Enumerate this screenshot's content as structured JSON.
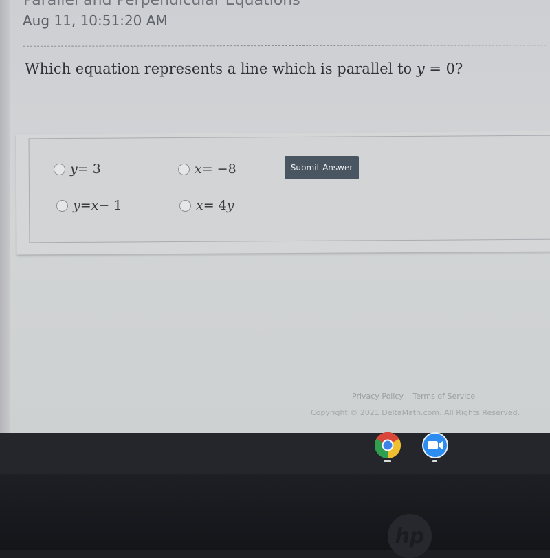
{
  "page": {
    "title": "Parallel and Perpendicular Equations",
    "timestamp": "Aug 11, 10:51:20 AM"
  },
  "question": {
    "prefix": "Which equation represents a line which is parallel to ",
    "math_var": "y",
    "math_rest": " = 0",
    "suffix": "?"
  },
  "choices": [
    {
      "id": "a",
      "lhs": "y",
      "rhs": " = 3",
      "selected": false
    },
    {
      "id": "b",
      "lhs": "x",
      "rhs": " = −8",
      "selected": false
    },
    {
      "id": "c",
      "lhs": "y",
      "rhs_mid": " = ",
      "rhs_var": "x",
      "rhs_end": " − 1",
      "selected": false
    },
    {
      "id": "d",
      "lhs": "x",
      "rhs_mid": " = 4",
      "rhs_var": "y",
      "rhs_end": "",
      "selected": false
    }
  ],
  "submit_label": "Submit Answer",
  "footer": {
    "privacy": "Privacy Policy",
    "terms": "Terms of Service",
    "copyright": "Copyright © 2021 DeltaMath.com. All Rights Reserved."
  },
  "shelf": {
    "apps": [
      {
        "name": "Chrome",
        "icon": "chrome-icon",
        "open": true
      },
      {
        "name": "Zoom",
        "icon": "zoom-icon",
        "open": true
      }
    ]
  },
  "device": {
    "brand": "hp"
  },
  "colors": {
    "submit_bg": "#4a5562",
    "chrome_red": "#d9473a",
    "chrome_green": "#2f9e4f",
    "chrome_yellow": "#eebf2f",
    "chrome_blue": "#3d82e8",
    "zoom_blue": "#2d8cf0"
  }
}
